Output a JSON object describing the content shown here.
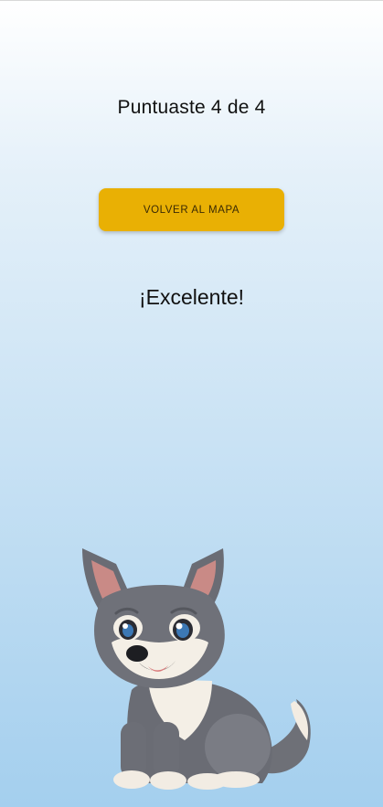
{
  "screen": {
    "score_text": "Puntuaste 4 de 4",
    "back_button_label": "VOLVER AL MAPA",
    "result_text": "¡Excelente!",
    "mascot_icon": "wolf-pup-illustration"
  },
  "colors": {
    "button_bg": "#e9b004",
    "button_text": "#3a2a05",
    "text": "#111111"
  }
}
